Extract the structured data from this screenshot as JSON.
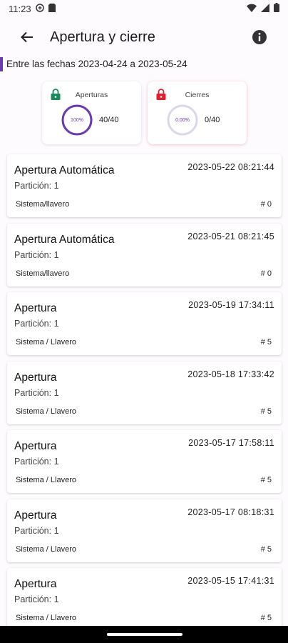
{
  "statusbar": {
    "time": "11:23"
  },
  "appbar": {
    "title": "Apertura y cierre"
  },
  "daterange": "Entre las fechas 2023-04-24 a 2023-05-24",
  "colors": {
    "accent": "#6a3ab2",
    "open_lock": "#1b8a5a",
    "close_lock": "#e02030",
    "ring_track": "#ddd6ea"
  },
  "summary": {
    "openings": {
      "label": "Aperturas",
      "percent_text": "100%",
      "percent": 1.0,
      "count": "40/40"
    },
    "closings": {
      "label": "Cierres",
      "percent_text": "0.00%",
      "percent": 0.0,
      "count": "0/40"
    }
  },
  "events": [
    {
      "title": "Apertura Automática",
      "date": "2023-05-22 08:21:44",
      "partition": "Partición: 1",
      "user": "Sistema/llavero",
      "number": "# 0"
    },
    {
      "title": "Apertura Automática",
      "date": "2023-05-21 08:21:45",
      "partition": "Partición: 1",
      "user": "Sistema/llavero",
      "number": "# 0"
    },
    {
      "title": "Apertura",
      "date": "2023-05-19 17:34:11",
      "partition": "Partición: 1",
      "user": "Sistema / Llavero",
      "number": "# 5"
    },
    {
      "title": "Apertura",
      "date": "2023-05-18 17:33:42",
      "partition": "Partición: 1",
      "user": "Sistema / Llavero",
      "number": "# 5"
    },
    {
      "title": "Apertura",
      "date": "2023-05-17 17:58:11",
      "partition": "Partición: 1",
      "user": "Sistema / Llavero",
      "number": "# 5"
    },
    {
      "title": "Apertura",
      "date": "2023-05-17 08:18:31",
      "partition": "Partición: 1",
      "user": "Sistema / Llavero",
      "number": "# 5"
    },
    {
      "title": "Apertura",
      "date": "2023-05-15 17:41:31",
      "partition": "Partición: 1",
      "user": "Sistema / Llavero",
      "number": "# 5"
    }
  ]
}
